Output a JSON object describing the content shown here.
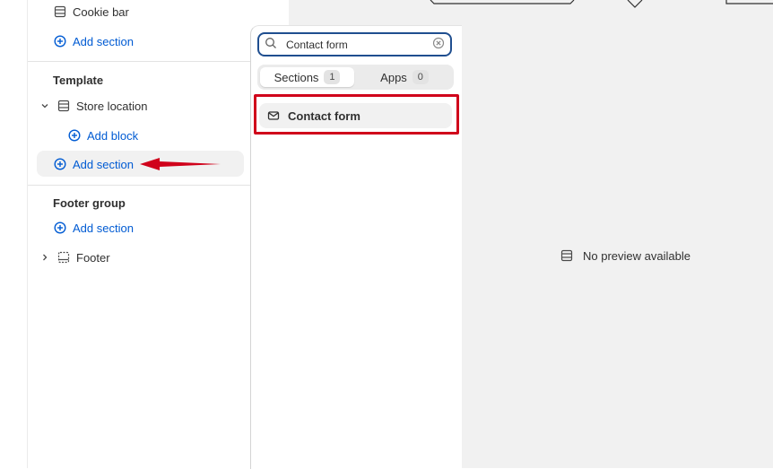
{
  "sidebar": {
    "top_item_label": "Cookie bar",
    "top_add_section": "Add section",
    "template": {
      "title": "Template",
      "section_label": "Store location",
      "add_block": "Add block",
      "add_section": "Add section"
    },
    "footer_group": {
      "title": "Footer group",
      "add_section": "Add section",
      "footer_label": "Footer"
    }
  },
  "popover": {
    "search_value": "Contact form",
    "tabs": [
      {
        "label": "Sections",
        "count": "1"
      },
      {
        "label": "Apps",
        "count": "0"
      }
    ],
    "results": [
      {
        "label": "Contact form",
        "icon": "envelope-icon"
      }
    ]
  },
  "preview": {
    "message": "No preview available"
  },
  "colors": {
    "link": "#005bd3",
    "annotation": "#d0021b",
    "search_focus": "#1f4e8f"
  }
}
